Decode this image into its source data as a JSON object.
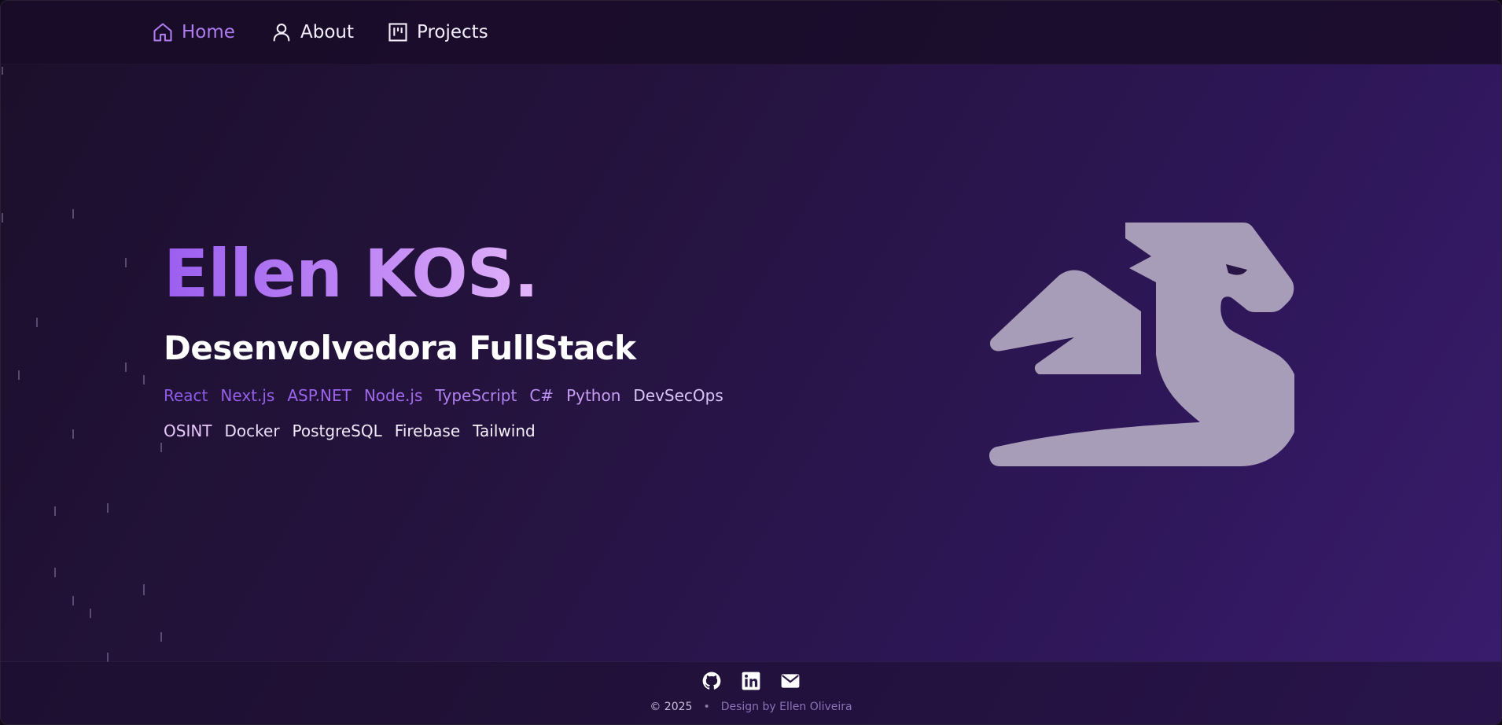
{
  "nav": {
    "items": [
      {
        "label": "Home",
        "icon": "home-icon",
        "active": true
      },
      {
        "label": "About",
        "icon": "user-icon",
        "active": false
      },
      {
        "label": "Projects",
        "icon": "kanban-icon",
        "active": false
      }
    ]
  },
  "hero": {
    "name": "Ellen KOS.",
    "role": "Desenvolvedora FullStack",
    "tech_row1": [
      "React",
      "Next.js",
      "ASP.NET",
      "Node.js",
      "TypeScript",
      "C#",
      "Python",
      "DevSecOps"
    ],
    "tech_row2": [
      "OSINT",
      "Docker",
      "PostgreSQL",
      "Firebase",
      "Tailwind"
    ]
  },
  "footer": {
    "social": [
      "github-icon",
      "linkedin-icon",
      "mail-icon"
    ],
    "copyright": "© 2025",
    "separator": "•",
    "credit": "Design by Ellen Oliveira"
  },
  "colors": {
    "accent": "#9b5ef0",
    "dragon": "#a89db8",
    "text": "#ffffff"
  }
}
